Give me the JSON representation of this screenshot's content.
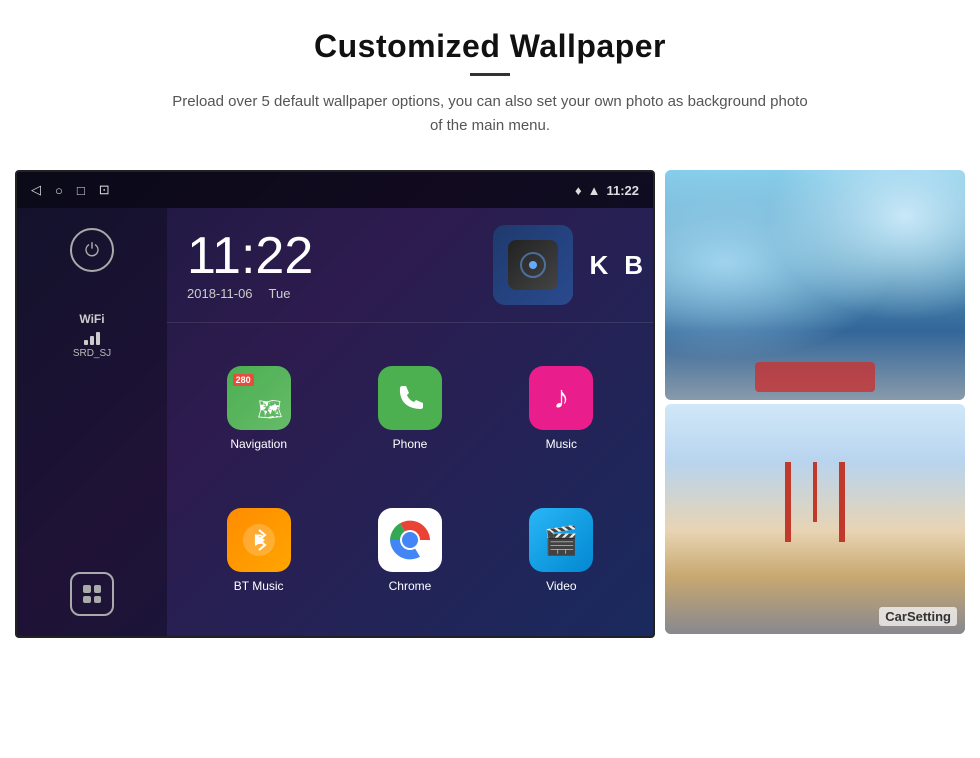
{
  "header": {
    "title": "Customized Wallpaper",
    "subtitle": "Preload over 5 default wallpaper options, you can also set your own photo as background photo of the main menu."
  },
  "statusBar": {
    "time": "11:22",
    "icons": [
      "back-arrow",
      "home-circle",
      "square",
      "image"
    ]
  },
  "clock": {
    "time": "11:22",
    "date": "2018-11-06",
    "day": "Tue"
  },
  "wifi": {
    "label": "WiFi",
    "ssid": "SRD_SJ"
  },
  "apps": [
    {
      "name": "Navigation",
      "type": "navigation"
    },
    {
      "name": "Phone",
      "type": "phone"
    },
    {
      "name": "Music",
      "type": "music"
    },
    {
      "name": "BT Music",
      "type": "bt"
    },
    {
      "name": "Chrome",
      "type": "chrome"
    },
    {
      "name": "Video",
      "type": "video"
    }
  ],
  "wallpapers": [
    {
      "label": ""
    },
    {
      "label": "CarSetting"
    }
  ]
}
